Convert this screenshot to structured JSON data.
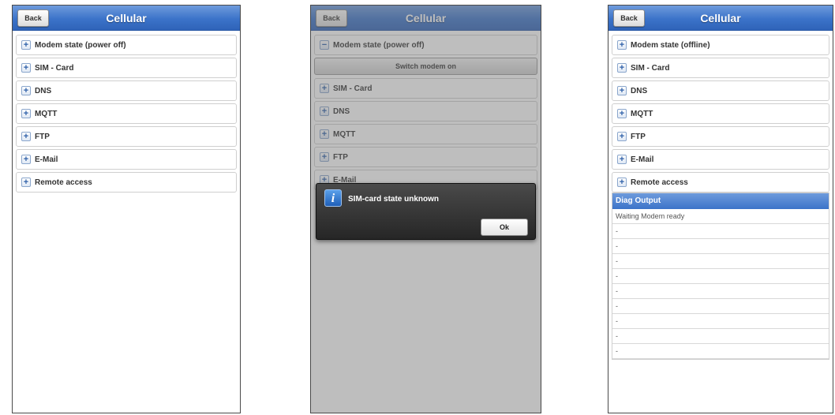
{
  "phone1": {
    "back": "Back",
    "title": "Cellular",
    "items": [
      {
        "sign": "+",
        "label": "Modem state (power off)"
      },
      {
        "sign": "+",
        "label": "SIM - Card"
      },
      {
        "sign": "+",
        "label": "DNS"
      },
      {
        "sign": "+",
        "label": "MQTT"
      },
      {
        "sign": "+",
        "label": "FTP"
      },
      {
        "sign": "+",
        "label": "E-Mail"
      },
      {
        "sign": "+",
        "label": "Remote access"
      }
    ]
  },
  "phone2": {
    "back": "Back",
    "title": "Cellular",
    "items": [
      {
        "sign": "−",
        "label": "Modem state (power off)"
      },
      {
        "sign": "+",
        "label": "SIM - Card"
      },
      {
        "sign": "+",
        "label": "DNS"
      },
      {
        "sign": "+",
        "label": "MQTT"
      },
      {
        "sign": "+",
        "label": "FTP"
      },
      {
        "sign": "+",
        "label": "E-Mail"
      }
    ],
    "switch_button": "Switch modem on",
    "dialog": {
      "icon": "info-icon",
      "icon_glyph": "i",
      "message": "SIM-card state unknown",
      "ok": "Ok"
    }
  },
  "phone3": {
    "back": "Back",
    "title": "Cellular",
    "items": [
      {
        "sign": "+",
        "label": "Modem state (offline)"
      },
      {
        "sign": "+",
        "label": "SIM - Card"
      },
      {
        "sign": "+",
        "label": "DNS"
      },
      {
        "sign": "+",
        "label": "MQTT"
      },
      {
        "sign": "+",
        "label": "FTP"
      },
      {
        "sign": "+",
        "label": "E-Mail"
      },
      {
        "sign": "+",
        "label": "Remote access"
      }
    ],
    "diag": {
      "title": "Diag Output",
      "lines": [
        "Waiting Modem ready",
        "-",
        "-",
        "-",
        "-",
        "-",
        "-",
        "-",
        "-",
        "-"
      ]
    }
  },
  "colors": {
    "header_blue": "#3b73c9",
    "dialog_bg": "#2e2e2e"
  }
}
